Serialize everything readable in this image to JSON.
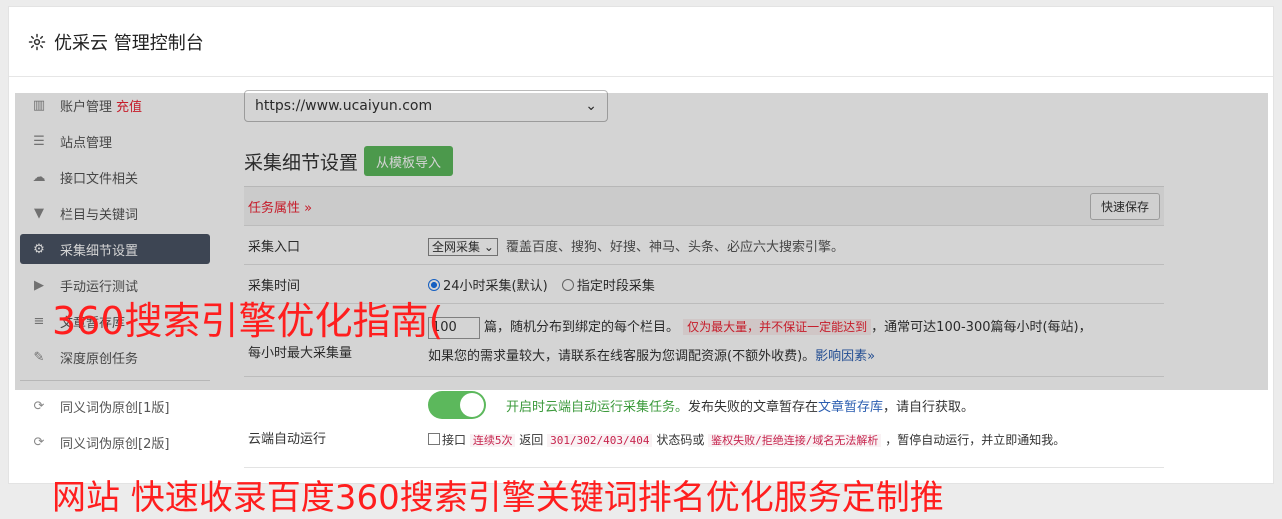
{
  "header": {
    "title": "优采云 管理控制台",
    "icon": "gear-icon"
  },
  "sidebar": {
    "items": [
      {
        "label": "账户管理",
        "tag": "充值",
        "icon": "bar-chart-icon"
      },
      {
        "label": "站点管理",
        "icon": "server-icon"
      },
      {
        "label": "接口文件相关",
        "icon": "cloud-upload-icon"
      },
      {
        "label": "栏目与关键词",
        "icon": "filter-icon"
      },
      {
        "label": "采集细节设置",
        "icon": "gears-icon",
        "active": true
      },
      {
        "label": "手动运行测试",
        "icon": "play-circle-icon"
      },
      {
        "label": "文章暂存库",
        "icon": "database-icon"
      },
      {
        "label": "深度原创任务",
        "icon": "edit-icon"
      },
      {
        "label": "同义词伪原创[1版]",
        "icon": "refresh-icon"
      },
      {
        "label": "同义词伪原创[2版]",
        "icon": "refresh-icon"
      }
    ]
  },
  "main": {
    "site_select": "https://www.ucaiyun.com",
    "section_title": "采集细节设置",
    "import_button": "从模板导入",
    "task_attr": "任务属性 »",
    "quick_save": "快速保存",
    "rows": {
      "entry": {
        "label": "采集入口",
        "select": "全网采集",
        "desc": "覆盖百度、搜狗、好搜、神马、头条、必应六大搜索引擎。"
      },
      "time": {
        "label": "采集时间",
        "opt1": "24小时采集(默认)",
        "opt2": "指定时段采集"
      },
      "max": {
        "label": "每小时最大采集量",
        "value": "100",
        "desc1": "篇，随机分布到绑定的每个栏目。",
        "warn": "仅为最大量，并不保证一定能达到",
        "desc2": "，通常可达100-300篇每小时(每站)，",
        "desc3": "如果您的需求量较大，请联系在线客服为您调配资源(不额外收费)。",
        "link": "影响因素»"
      },
      "cloud": {
        "label": "云端自动运行",
        "on_text": "开启时云端自动运行采集任务。",
        "desc": "发布失败的文章暂存在",
        "link": "文章暂存库",
        "desc_end": "，请自行获取。",
        "check_label": "接口",
        "warn1": "连续5次",
        "ret": "返回",
        "codes": "301/302/403/404",
        "status": "状态码或",
        "warn2": "鉴权失败/拒绝连接/域名无法解析",
        "end": "，暂停自动运行，并立即通知我。"
      }
    }
  },
  "watermark": {
    "line1": "360搜索引擎优化指南(",
    "line2": "网站 快速收录百度360搜索引擎关键词排名优化服务定制推"
  }
}
